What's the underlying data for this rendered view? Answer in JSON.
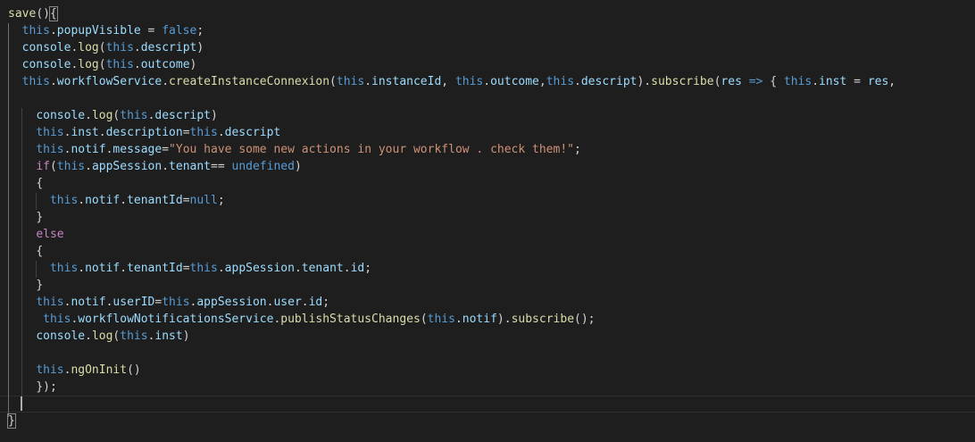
{
  "theme": {
    "background": "#1e1e1e",
    "plain": "#d4d4d4",
    "keyword": "#569cd6",
    "property": "#9cdcfe",
    "function": "#dcdcaa",
    "string": "#ce9178",
    "control": "#c586c0"
  },
  "code": {
    "lines": [
      [
        [
          "save",
          "fn"
        ],
        [
          "(",
          "p"
        ],
        [
          ")",
          "p"
        ],
        [
          "{",
          "pb"
        ]
      ],
      [
        [
          "  ",
          "p"
        ],
        [
          "this",
          "kw"
        ],
        [
          ".",
          "p"
        ],
        [
          "popupVisible",
          "prop"
        ],
        [
          " = ",
          "p"
        ],
        [
          "false",
          "kw"
        ],
        [
          ";",
          "p"
        ]
      ],
      [
        [
          "  ",
          "p"
        ],
        [
          "console",
          "prop"
        ],
        [
          ".",
          "p"
        ],
        [
          "log",
          "fn"
        ],
        [
          "(",
          "p"
        ],
        [
          "this",
          "kw"
        ],
        [
          ".",
          "p"
        ],
        [
          "descript",
          "prop"
        ],
        [
          ")",
          "p"
        ]
      ],
      [
        [
          "  ",
          "p"
        ],
        [
          "console",
          "prop"
        ],
        [
          ".",
          "p"
        ],
        [
          "log",
          "fn"
        ],
        [
          "(",
          "p"
        ],
        [
          "this",
          "kw"
        ],
        [
          ".",
          "p"
        ],
        [
          "outcome",
          "prop"
        ],
        [
          ")",
          "p"
        ]
      ],
      [
        [
          "  ",
          "p"
        ],
        [
          "this",
          "kw"
        ],
        [
          ".",
          "p"
        ],
        [
          "workflowService",
          "prop"
        ],
        [
          ".",
          "p"
        ],
        [
          "createInstanceConnexion",
          "fn"
        ],
        [
          "(",
          "p"
        ],
        [
          "this",
          "kw"
        ],
        [
          ".",
          "p"
        ],
        [
          "instanceId",
          "prop"
        ],
        [
          ", ",
          "p"
        ],
        [
          "this",
          "kw"
        ],
        [
          ".",
          "p"
        ],
        [
          "outcome",
          "prop"
        ],
        [
          ",",
          "p"
        ],
        [
          "this",
          "kw"
        ],
        [
          ".",
          "p"
        ],
        [
          "descript",
          "prop"
        ],
        [
          ").",
          "p"
        ],
        [
          "subscribe",
          "fn"
        ],
        [
          "(",
          "p"
        ],
        [
          "res",
          "prop"
        ],
        [
          " ",
          "p"
        ],
        [
          "=>",
          "kw"
        ],
        [
          " { ",
          "p"
        ],
        [
          "this",
          "kw"
        ],
        [
          ".",
          "p"
        ],
        [
          "inst",
          "prop"
        ],
        [
          " = ",
          "p"
        ],
        [
          "res",
          "prop"
        ],
        [
          ",",
          "p"
        ]
      ],
      [],
      [
        [
          "    ",
          "p"
        ],
        [
          "console",
          "prop"
        ],
        [
          ".",
          "p"
        ],
        [
          "log",
          "fn"
        ],
        [
          "(",
          "p"
        ],
        [
          "this",
          "kw"
        ],
        [
          ".",
          "p"
        ],
        [
          "descript",
          "prop"
        ],
        [
          ")",
          "p"
        ]
      ],
      [
        [
          "    ",
          "p"
        ],
        [
          "this",
          "kw"
        ],
        [
          ".",
          "p"
        ],
        [
          "inst",
          "prop"
        ],
        [
          ".",
          "p"
        ],
        [
          "description",
          "prop"
        ],
        [
          "=",
          "p"
        ],
        [
          "this",
          "kw"
        ],
        [
          ".",
          "p"
        ],
        [
          "descript",
          "prop"
        ]
      ],
      [
        [
          "    ",
          "p"
        ],
        [
          "this",
          "kw"
        ],
        [
          ".",
          "p"
        ],
        [
          "notif",
          "prop"
        ],
        [
          ".",
          "p"
        ],
        [
          "message",
          "prop"
        ],
        [
          "=",
          "p"
        ],
        [
          "\"You have some new actions in your workflow . check them!\"",
          "str"
        ],
        [
          ";",
          "p"
        ]
      ],
      [
        [
          "    ",
          "p"
        ],
        [
          "if",
          "ctl"
        ],
        [
          "(",
          "p"
        ],
        [
          "this",
          "kw"
        ],
        [
          ".",
          "p"
        ],
        [
          "appSession",
          "prop"
        ],
        [
          ".",
          "p"
        ],
        [
          "tenant",
          "prop"
        ],
        [
          "== ",
          "p"
        ],
        [
          "undefined",
          "kw"
        ],
        [
          ")",
          "p"
        ]
      ],
      [
        [
          "    ",
          "p"
        ],
        [
          "{",
          "p"
        ]
      ],
      [
        [
          "      ",
          "p"
        ],
        [
          "this",
          "kw"
        ],
        [
          ".",
          "p"
        ],
        [
          "notif",
          "prop"
        ],
        [
          ".",
          "p"
        ],
        [
          "tenantId",
          "prop"
        ],
        [
          "=",
          "p"
        ],
        [
          "null",
          "kw"
        ],
        [
          ";",
          "p"
        ]
      ],
      [
        [
          "    ",
          "p"
        ],
        [
          "}",
          "p"
        ]
      ],
      [
        [
          "    ",
          "p"
        ],
        [
          "else",
          "ctl"
        ]
      ],
      [
        [
          "    ",
          "p"
        ],
        [
          "{",
          "p"
        ]
      ],
      [
        [
          "      ",
          "p"
        ],
        [
          "this",
          "kw"
        ],
        [
          ".",
          "p"
        ],
        [
          "notif",
          "prop"
        ],
        [
          ".",
          "p"
        ],
        [
          "tenantId",
          "prop"
        ],
        [
          "=",
          "p"
        ],
        [
          "this",
          "kw"
        ],
        [
          ".",
          "p"
        ],
        [
          "appSession",
          "prop"
        ],
        [
          ".",
          "p"
        ],
        [
          "tenant",
          "prop"
        ],
        [
          ".",
          "p"
        ],
        [
          "id",
          "prop"
        ],
        [
          ";",
          "p"
        ]
      ],
      [
        [
          "    ",
          "p"
        ],
        [
          "}",
          "p"
        ]
      ],
      [
        [
          "    ",
          "p"
        ],
        [
          "this",
          "kw"
        ],
        [
          ".",
          "p"
        ],
        [
          "notif",
          "prop"
        ],
        [
          ".",
          "p"
        ],
        [
          "userID",
          "prop"
        ],
        [
          "=",
          "p"
        ],
        [
          "this",
          "kw"
        ],
        [
          ".",
          "p"
        ],
        [
          "appSession",
          "prop"
        ],
        [
          ".",
          "p"
        ],
        [
          "user",
          "prop"
        ],
        [
          ".",
          "p"
        ],
        [
          "id",
          "prop"
        ],
        [
          ";",
          "p"
        ]
      ],
      [
        [
          "     ",
          "p"
        ],
        [
          "this",
          "kw"
        ],
        [
          ".",
          "p"
        ],
        [
          "workflowNotificationsService",
          "prop"
        ],
        [
          ".",
          "p"
        ],
        [
          "publishStatusChanges",
          "fn"
        ],
        [
          "(",
          "p"
        ],
        [
          "this",
          "kw"
        ],
        [
          ".",
          "p"
        ],
        [
          "notif",
          "prop"
        ],
        [
          ").",
          "p"
        ],
        [
          "subscribe",
          "fn"
        ],
        [
          "();",
          "p"
        ]
      ],
      [
        [
          "    ",
          "p"
        ],
        [
          "console",
          "prop"
        ],
        [
          ".",
          "p"
        ],
        [
          "log",
          "fn"
        ],
        [
          "(",
          "p"
        ],
        [
          "this",
          "kw"
        ],
        [
          ".",
          "p"
        ],
        [
          "inst",
          "prop"
        ],
        [
          ")",
          "p"
        ]
      ],
      [],
      [
        [
          "    ",
          "p"
        ],
        [
          "this",
          "kw"
        ],
        [
          ".",
          "p"
        ],
        [
          "ngOnInit",
          "fn"
        ],
        [
          "()",
          "p"
        ]
      ],
      [
        [
          "    ",
          "p"
        ],
        [
          "});",
          "p"
        ]
      ],
      [],
      [
        [
          "}",
          "pb"
        ]
      ]
    ]
  }
}
